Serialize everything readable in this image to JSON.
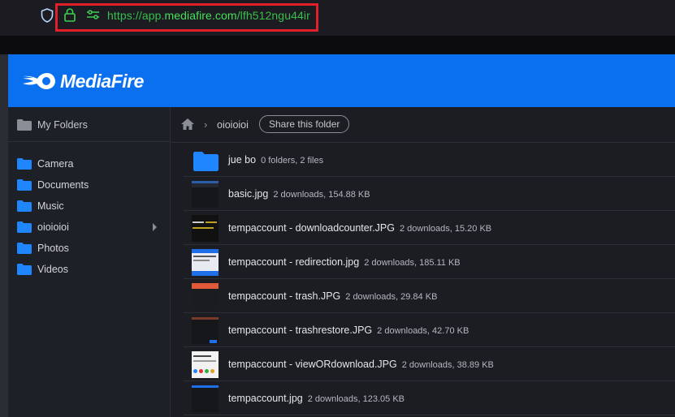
{
  "browser": {
    "url_prefix": "https://app.",
    "url_domain": "mediafire.com",
    "url_suffix": "/lfh512ngu44ir"
  },
  "brand": {
    "name": "MediaFire",
    "color": "#0a70f0"
  },
  "sidebar": {
    "header_label": "My Folders",
    "items": [
      {
        "label": "Camera"
      },
      {
        "label": "Documents"
      },
      {
        "label": "Music"
      },
      {
        "label": "oioioioi"
      },
      {
        "label": "Photos"
      },
      {
        "label": "Videos"
      }
    ]
  },
  "breadcrumb": {
    "folder": "oioioioi",
    "share_label": "Share this folder"
  },
  "rows": [
    {
      "name": "jue bo",
      "meta": "0 folders, 2 files",
      "type": "folder"
    },
    {
      "name": "basic.jpg",
      "meta": "2 downloads, 154.88 KB",
      "type": "image"
    },
    {
      "name": "tempaccount - downloadcounter.JPG",
      "meta": "2 downloads, 15.20 KB",
      "type": "image"
    },
    {
      "name": "tempaccount - redirection.jpg",
      "meta": "2 downloads, 185.11 KB",
      "type": "image"
    },
    {
      "name": "tempaccount - trash.JPG",
      "meta": "2 downloads, 29.84 KB",
      "type": "image"
    },
    {
      "name": "tempaccount - trashrestore.JPG",
      "meta": "2 downloads, 42.70 KB",
      "type": "image"
    },
    {
      "name": "tempaccount - viewORdownload.JPG",
      "meta": "2 downloads, 38.89 KB",
      "type": "image"
    },
    {
      "name": "tempaccount.jpg",
      "meta": "2 downloads, 123.05 KB",
      "type": "image"
    }
  ]
}
